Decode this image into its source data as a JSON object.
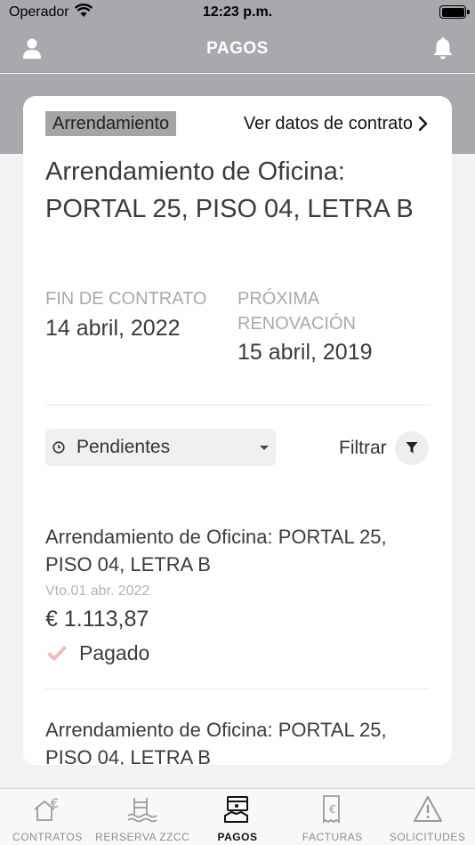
{
  "status_bar": {
    "carrier": "Operador",
    "time": "12:23 p.m."
  },
  "nav": {
    "title": "PAGOS",
    "left_icon": "user-icon",
    "right_icon": "bell-icon"
  },
  "contract": {
    "tag": "Arrendamiento",
    "view_link": "Ver datos de contrato",
    "title": "Arrendamiento de Oficina: PORTAL 25, PISO 04, LETRA B",
    "end_label": "FIN DE CONTRATO",
    "end_value": "14 abril, 2022",
    "renewal_label": "PRÓXIMA RENOVACIÓN",
    "renewal_value": "15 abril, 2019"
  },
  "filter": {
    "selected": "Pendientes",
    "filter_label": "Filtrar",
    "filter_icon": "funnel-icon"
  },
  "payments": [
    {
      "title": "Arrendamiento de Oficina: PORTAL 25, PISO 04, LETRA B",
      "due": "Vto.01 abr. 2022",
      "amount": "€ 1.113,87",
      "status": "Pagado"
    },
    {
      "title": "Arrendamiento de Oficina: PORTAL 25, PISO 04, LETRA B"
    }
  ],
  "tabs": [
    {
      "label": "CONTRATOS",
      "icon": "house-euro-icon"
    },
    {
      "label": "RERSERVA ZZCC",
      "icon": "pool-icon"
    },
    {
      "label": "PAGOS",
      "icon": "payment-icon"
    },
    {
      "label": "FACTURAS",
      "icon": "invoice-icon"
    },
    {
      "label": "SOLICITUDES",
      "icon": "warning-icon"
    }
  ],
  "colors": {
    "header_gray": "#a7a9ad",
    "check_pink": "#f2b8c0",
    "active_tab": "#111111"
  }
}
